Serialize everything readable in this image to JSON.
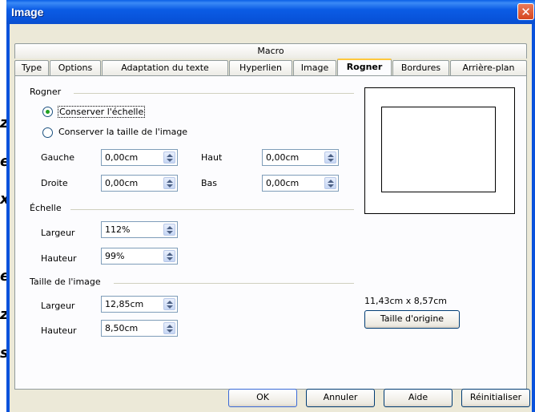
{
  "window": {
    "title": "Image",
    "close_glyph": "✕"
  },
  "tabs_row1": [
    {
      "label": "Macro"
    }
  ],
  "tabs_row2": [
    {
      "label": "Type"
    },
    {
      "label": "Options"
    },
    {
      "label": "Adaptation du texte"
    },
    {
      "label": "Hyperlien"
    },
    {
      "label": "Image"
    },
    {
      "label": "Rogner",
      "active": true
    },
    {
      "label": "Bordures"
    },
    {
      "label": "Arrière-plan"
    }
  ],
  "crop": {
    "group": "Rogner",
    "radio_keep_scale": "Conserver l'échelle",
    "radio_keep_size": "Conserver la taille de l'image",
    "selected": "keep_scale",
    "left_label": "Gauche",
    "left_value": "0,00cm",
    "right_label": "Droite",
    "right_value": "0,00cm",
    "top_label": "Haut",
    "top_value": "0,00cm",
    "bottom_label": "Bas",
    "bottom_value": "0,00cm"
  },
  "scale": {
    "group": "Échelle",
    "width_label": "Largeur",
    "width_value": "112%",
    "height_label": "Hauteur",
    "height_value": "99%"
  },
  "size": {
    "group": "Taille de l'image",
    "width_label": "Largeur",
    "width_value": "12,85cm",
    "height_label": "Hauteur",
    "height_value": "8,50cm"
  },
  "preview": {
    "original_size": "11,43cm x 8,57cm",
    "original_button": "Taille d'origine"
  },
  "buttons": {
    "ok": "OK",
    "cancel": "Annuler",
    "help": "Aide",
    "reset": "Réinitialiser"
  },
  "background_fragments": [
    "z",
    "e",
    "x",
    "e",
    "z",
    "s"
  ]
}
